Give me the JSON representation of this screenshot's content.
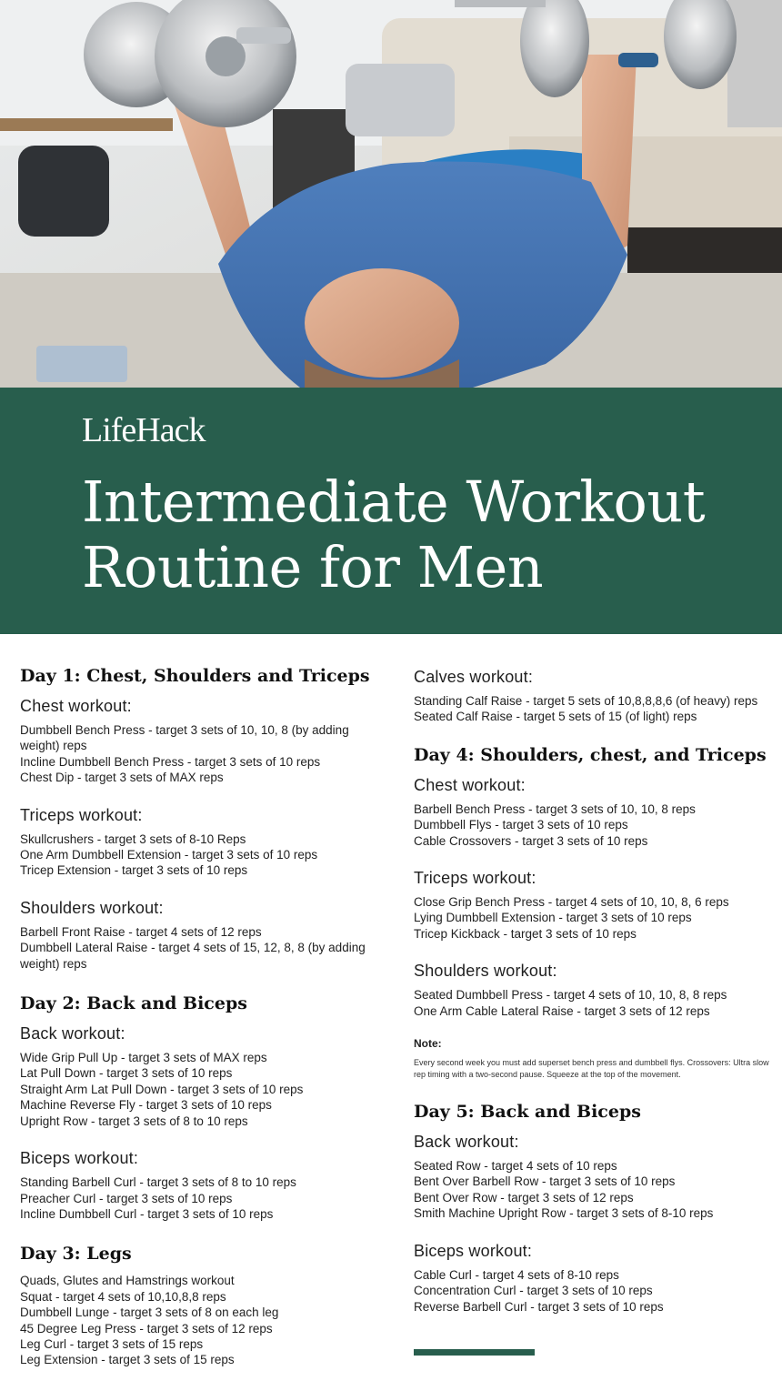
{
  "brand": {
    "logo": "LifeHack",
    "accent_color": "#285e4d"
  },
  "title": {
    "line1": "Intermediate Workout",
    "line2": "Routine for Men"
  },
  "left": {
    "day1": {
      "heading": "Day 1: Chest, Shoulders and Triceps",
      "chest": {
        "heading": "Chest workout:",
        "items": [
          "Dumbbell Bench Press - target 3 sets of 10, 10, 8 (by adding weight) reps",
          "Incline Dumbbell Bench Press - target 3 sets of 10 reps",
          "Chest Dip - target 3 sets of MAX reps"
        ]
      },
      "triceps": {
        "heading": "Triceps workout:",
        "items": [
          "Skullcrushers - target 3 sets of 8-10 Reps",
          "One Arm Dumbbell Extension - target 3 sets of 10 reps",
          "Tricep Extension - target 3 sets of 10 reps"
        ]
      },
      "shoulders": {
        "heading": "Shoulders workout:",
        "items": [
          "Barbell Front Raise - target 4 sets of 12 reps",
          "Dumbbell Lateral Raise - target 4 sets of 15, 12, 8, 8 (by adding weight) reps"
        ]
      }
    },
    "day2": {
      "heading": "Day 2: Back and Biceps",
      "back": {
        "heading": "Back workout:",
        "items": [
          "Wide Grip Pull Up - target 3 sets of MAX reps",
          "Lat Pull Down - target 3 sets of 10 reps",
          "Straight Arm Lat Pull Down - target 3 sets of 10 reps",
          "Machine Reverse Fly - target 3 sets of 10 reps",
          "Upright Row - target 3 sets of 8 to 10 reps"
        ]
      },
      "biceps": {
        "heading": "Biceps workout:",
        "items": [
          "Standing Barbell Curl - target 3 sets of 8 to 10 reps",
          "Preacher Curl - target 3 sets of 10 reps",
          "Incline Dumbbell Curl - target 3 sets of 10 reps"
        ]
      }
    },
    "day3": {
      "heading": "Day 3: Legs",
      "items": [
        "Quads, Glutes and Hamstrings workout",
        "Squat - target 4 sets of 10,10,8,8 reps",
        "Dumbbell Lunge - target 3 sets of 8 on each leg",
        "45 Degree Leg Press - target 3 sets of 12 reps",
        "Leg Curl - target 3 sets of 15 reps",
        "Leg Extension - target 3 sets of 15 reps"
      ]
    }
  },
  "right": {
    "calves": {
      "heading": "Calves workout:",
      "items": [
        "Standing Calf Raise - target 5 sets of 10,8,8,8,6 (of heavy) reps",
        "Seated Calf Raise - target 5 sets of 15 (of light) reps"
      ]
    },
    "day4": {
      "heading": "Day 4: Shoulders, chest, and Triceps",
      "chest": {
        "heading": "Chest workout:",
        "items": [
          "Barbell Bench Press - target 3 sets of 10, 10, 8 reps",
          "Dumbbell Flys - target 3 sets of 10 reps",
          "Cable Crossovers - target 3 sets of 10 reps"
        ]
      },
      "triceps": {
        "heading": "Triceps workout:",
        "items": [
          "Close Grip Bench Press - target 4 sets of 10, 10, 8, 6 reps",
          "Lying Dumbbell Extension - target 3 sets of 10 reps",
          "Tricep Kickback - target 3 sets of 10 reps"
        ]
      },
      "shoulders": {
        "heading": "Shoulders workout:",
        "items": [
          "Seated Dumbbell Press - target 4 sets of 10, 10, 8, 8 reps",
          "One Arm Cable Lateral Raise - target 3 sets of 12 reps"
        ]
      },
      "note": {
        "title": "Note:",
        "text": "Every second week you must add superset bench press and dumbbell flys. Crossovers: Ultra slow rep timing with a two-second pause. Squeeze at the top of the movement."
      }
    },
    "day5": {
      "heading": "Day 5: Back and Biceps",
      "back": {
        "heading": "Back workout:",
        "items": [
          "Seated Row - target 4 sets of 10 reps",
          "Bent Over Barbell Row - target 3 sets of 10 reps",
          "Bent Over Row - target 3 sets of 12 reps",
          "Smith Machine Upright Row - target 3 sets of 8-10 reps"
        ]
      },
      "biceps": {
        "heading": "Biceps workout:",
        "items": [
          "Cable Curl - target 4 sets of 8-10 reps",
          "Concentration Curl - target 3 sets of 10 reps",
          "Reverse Barbell Curl - target 3 sets of 10 reps"
        ]
      }
    }
  }
}
